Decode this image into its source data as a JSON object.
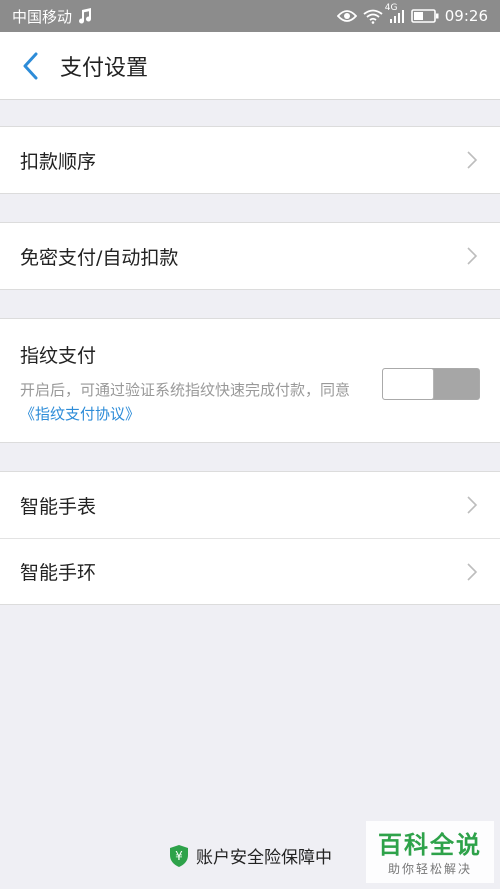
{
  "status_bar": {
    "carrier": "中国移动",
    "network": "4G",
    "time": "09:26"
  },
  "nav": {
    "title": "支付设置"
  },
  "groups": {
    "deduction_order": "扣款顺序",
    "password_free": "免密支付/自动扣款",
    "fingerprint": {
      "title": "指纹支付",
      "desc": "开启后，可通过验证系统指纹快速完成付款，同意",
      "link": "《指纹支付协议》",
      "enabled": false
    },
    "smart_watch": "智能手表",
    "smart_band": "智能手环"
  },
  "footer": {
    "text": "账户安全险保障中",
    "badge_symbol": "¥",
    "badge_color": "#2ea24a"
  },
  "watermark": {
    "main": "百科全说",
    "sub": "助你轻松解决"
  },
  "colors": {
    "accent": "#2d8cd8",
    "status_bg": "#8c8c8c"
  }
}
